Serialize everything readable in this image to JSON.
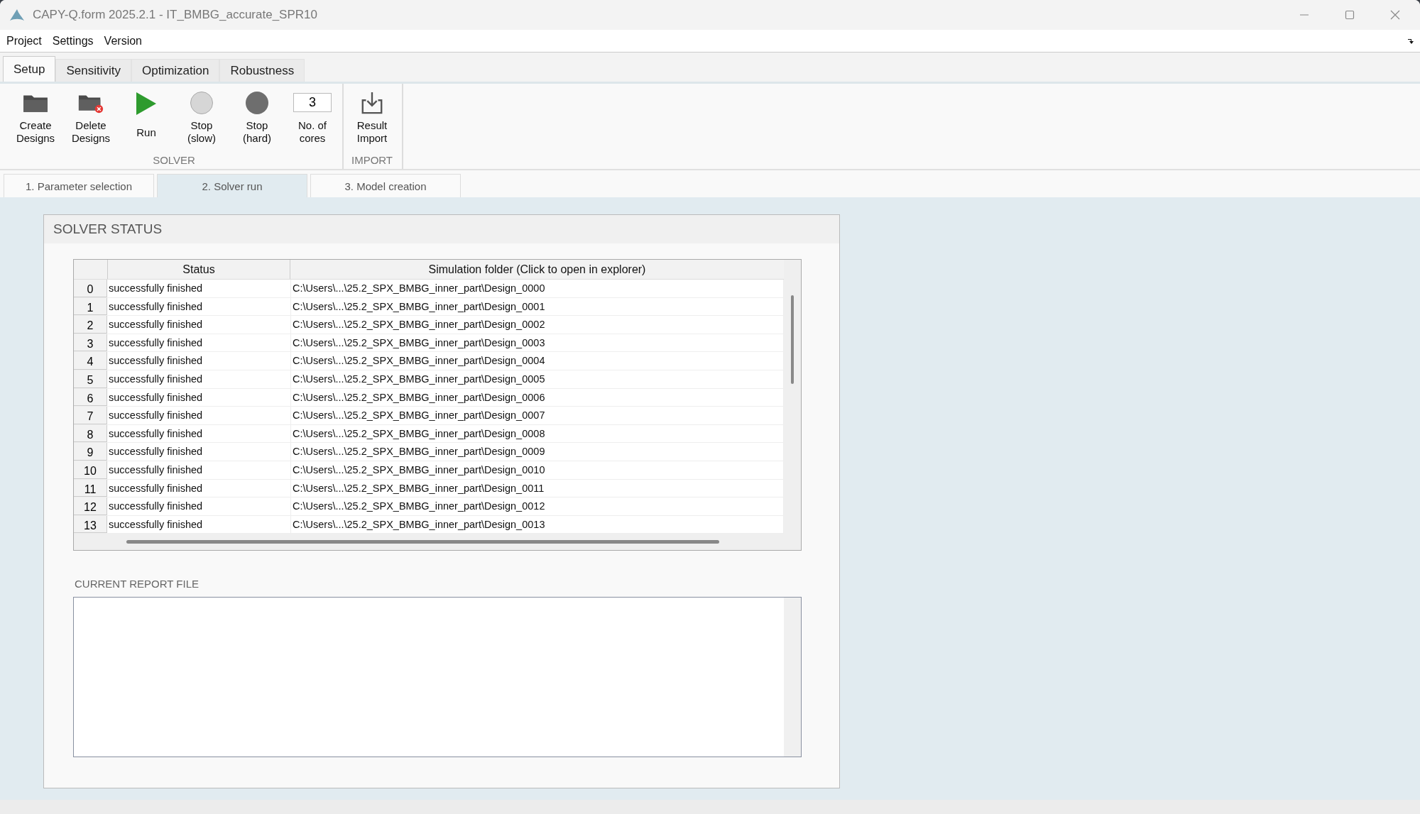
{
  "window": {
    "title": "CAPY-Q.form 2025.2.1 - IT_BMBG_accurate_SPR10"
  },
  "menu": [
    "Project",
    "Settings",
    "Version"
  ],
  "ribbon_tabs": [
    {
      "label": "Setup",
      "selected": true
    },
    {
      "label": "Sensitivity",
      "selected": false
    },
    {
      "label": "Optimization",
      "selected": false
    },
    {
      "label": "Robustness",
      "selected": false
    }
  ],
  "toolbar_groups": [
    {
      "label": "SOLVER",
      "items": [
        {
          "kind": "create",
          "label": "Create\nDesigns"
        },
        {
          "kind": "delete",
          "label": "Delete\nDesigns"
        },
        {
          "kind": "run",
          "label": "Run"
        },
        {
          "kind": "stopslow",
          "label": "Stop\n(slow)"
        },
        {
          "kind": "stophard",
          "label": "Stop\n(hard)"
        },
        {
          "kind": "field",
          "value": "3",
          "label": "No. of\ncores"
        }
      ]
    },
    {
      "label": "IMPORT",
      "items": [
        {
          "kind": "import",
          "label": "Result\nImport"
        }
      ]
    }
  ],
  "step_tabs": [
    {
      "label": "1. Parameter selection",
      "selected": false
    },
    {
      "label": "2. Solver run",
      "selected": true
    },
    {
      "label": "3. Model creation",
      "selected": false
    }
  ],
  "panel": {
    "title": "SOLVER STATUS",
    "table": {
      "columns": [
        "Status",
        "Simulation folder (Click to open in explorer)"
      ],
      "rows": [
        {
          "index": "0",
          "status": "successfully finished",
          "folder": "C:\\Users\\...\\25.2_SPX_BMBG_inner_part\\Design_0000"
        },
        {
          "index": "1",
          "status": "successfully finished",
          "folder": "C:\\Users\\...\\25.2_SPX_BMBG_inner_part\\Design_0001"
        },
        {
          "index": "2",
          "status": "successfully finished",
          "folder": "C:\\Users\\...\\25.2_SPX_BMBG_inner_part\\Design_0002"
        },
        {
          "index": "3",
          "status": "successfully finished",
          "folder": "C:\\Users\\...\\25.2_SPX_BMBG_inner_part\\Design_0003"
        },
        {
          "index": "4",
          "status": "successfully finished",
          "folder": "C:\\Users\\...\\25.2_SPX_BMBG_inner_part\\Design_0004"
        },
        {
          "index": "5",
          "status": "successfully finished",
          "folder": "C:\\Users\\...\\25.2_SPX_BMBG_inner_part\\Design_0005"
        },
        {
          "index": "6",
          "status": "successfully finished",
          "folder": "C:\\Users\\...\\25.2_SPX_BMBG_inner_part\\Design_0006"
        },
        {
          "index": "7",
          "status": "successfully finished",
          "folder": "C:\\Users\\...\\25.2_SPX_BMBG_inner_part\\Design_0007"
        },
        {
          "index": "8",
          "status": "successfully finished",
          "folder": "C:\\Users\\...\\25.2_SPX_BMBG_inner_part\\Design_0008"
        },
        {
          "index": "9",
          "status": "successfully finished",
          "folder": "C:\\Users\\...\\25.2_SPX_BMBG_inner_part\\Design_0009"
        },
        {
          "index": "10",
          "status": "successfully finished",
          "folder": "C:\\Users\\...\\25.2_SPX_BMBG_inner_part\\Design_0010"
        },
        {
          "index": "11",
          "status": "successfully finished",
          "folder": "C:\\Users\\...\\25.2_SPX_BMBG_inner_part\\Design_0011"
        },
        {
          "index": "12",
          "status": "successfully finished",
          "folder": "C:\\Users\\...\\25.2_SPX_BMBG_inner_part\\Design_0012"
        },
        {
          "index": "13",
          "status": "successfully finished",
          "folder": "C:\\Users\\...\\25.2_SPX_BMBG_inner_part\\Design_0013"
        }
      ]
    },
    "report_label": "CURRENT REPORT FILE"
  }
}
